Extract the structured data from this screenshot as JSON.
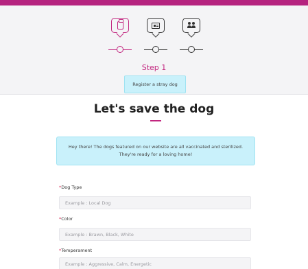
{
  "colors": {
    "accent": "#c2267f",
    "top_bar": "#b5237f",
    "info_bg": "#c9f1fb",
    "required": "#d61f4f"
  },
  "stepper": {
    "steps": [
      {
        "icon": "clipboard-icon",
        "active": true
      },
      {
        "icon": "id-card-icon",
        "active": false
      },
      {
        "icon": "people-icon",
        "active": false
      }
    ],
    "current_step_title": "Step 1",
    "current_step_description": "Register a stray dog"
  },
  "main": {
    "title": "Let's save the dog",
    "info_text": "Hey there! The dogs featured on our website are all vaccinated and sterilized. They're ready for a loving home!"
  },
  "form": {
    "fields": [
      {
        "required_mark": "*",
        "label": "Dog Type",
        "placeholder": "Example : Local Dog"
      },
      {
        "required_mark": "*",
        "label": "Color",
        "placeholder": "Example : Brawn, Black, White"
      },
      {
        "required_mark": "*",
        "label": "Temperament",
        "placeholder": "Example : Aggressive, Calm, Energetic"
      }
    ]
  }
}
